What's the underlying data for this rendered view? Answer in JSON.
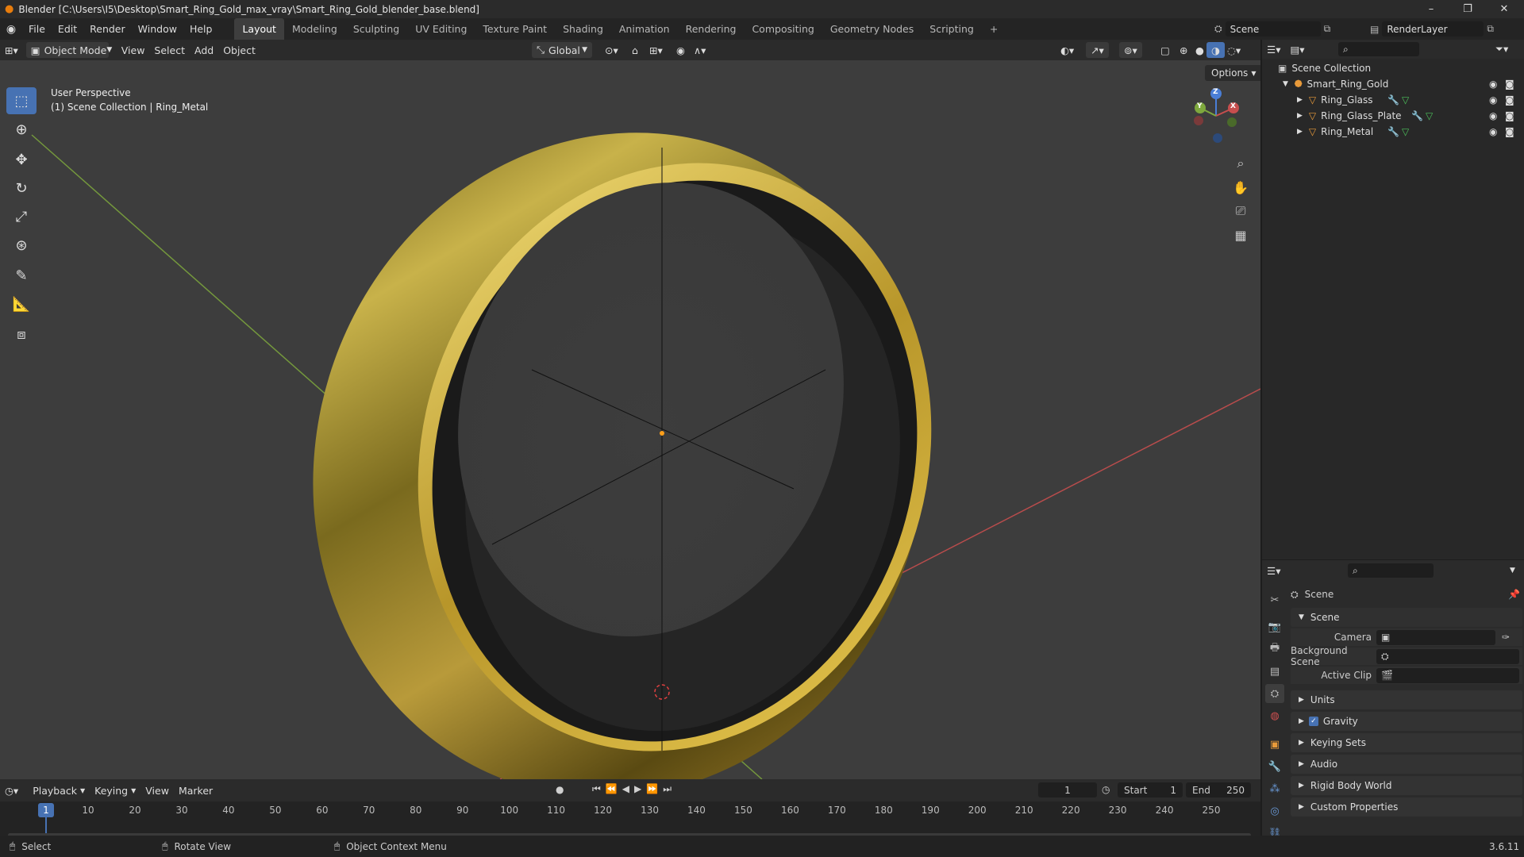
{
  "window": {
    "title": "Blender [C:\\Users\\I5\\Desktop\\Smart_Ring_Gold_max_vray\\Smart_Ring_Gold_blender_base.blend]",
    "minimize": "–",
    "maximize": "❐",
    "close": "✕"
  },
  "menubar": {
    "items": [
      "File",
      "Edit",
      "Render",
      "Window",
      "Help"
    ]
  },
  "workspaces": {
    "tabs": [
      "Layout",
      "Modeling",
      "Sculpting",
      "UV Editing",
      "Texture Paint",
      "Shading",
      "Animation",
      "Rendering",
      "Compositing",
      "Geometry Nodes",
      "Scripting"
    ],
    "active": "Layout",
    "add": "+"
  },
  "scene_selector": {
    "value": "Scene"
  },
  "view_layer": {
    "value": "RenderLayer"
  },
  "viewport_header": {
    "mode": "Object Mode",
    "menus": [
      "View",
      "Select",
      "Add",
      "Object"
    ],
    "transform_orientation": "Global",
    "options": "Options"
  },
  "viewport": {
    "perspective_label": "User Perspective",
    "context_label": "(1) Scene Collection | Ring_Metal",
    "gizmo": {
      "x": "X",
      "y": "Y",
      "z": "Z"
    }
  },
  "outliner": {
    "root": "Scene Collection",
    "collection": "Smart_Ring_Gold",
    "objects": [
      "Ring_Glass",
      "Ring_Glass_Plate",
      "Ring_Metal"
    ]
  },
  "properties": {
    "context_title": "Scene",
    "panel_scene": "Scene",
    "fields": {
      "camera_label": "Camera",
      "background_scene_label": "Background Scene",
      "active_clip_label": "Active Clip"
    },
    "categories": [
      "Units",
      "Gravity",
      "Keying Sets",
      "Audio",
      "Rigid Body World",
      "Custom Properties"
    ],
    "gravity_checked": true
  },
  "timeline": {
    "menus": [
      "Playback",
      "Keying",
      "View",
      "Marker"
    ],
    "current_frame": "1",
    "start_label": "Start",
    "start_value": "1",
    "end_label": "End",
    "end_value": "250",
    "ticks": [
      "1",
      "10",
      "20",
      "30",
      "40",
      "50",
      "60",
      "70",
      "80",
      "90",
      "100",
      "110",
      "120",
      "130",
      "140",
      "150",
      "160",
      "170",
      "180",
      "190",
      "200",
      "210",
      "220",
      "230",
      "240",
      "250"
    ]
  },
  "statusbar": {
    "select": "Select",
    "rotate": "Rotate View",
    "context_menu": "Object Context Menu",
    "version": "3.6.11"
  },
  "colors": {
    "accent": "#4772b3",
    "axis_x": "#c74e4e",
    "axis_y": "#7ea83d",
    "gold": "#b8962a",
    "origin": "#ff9f1a"
  }
}
